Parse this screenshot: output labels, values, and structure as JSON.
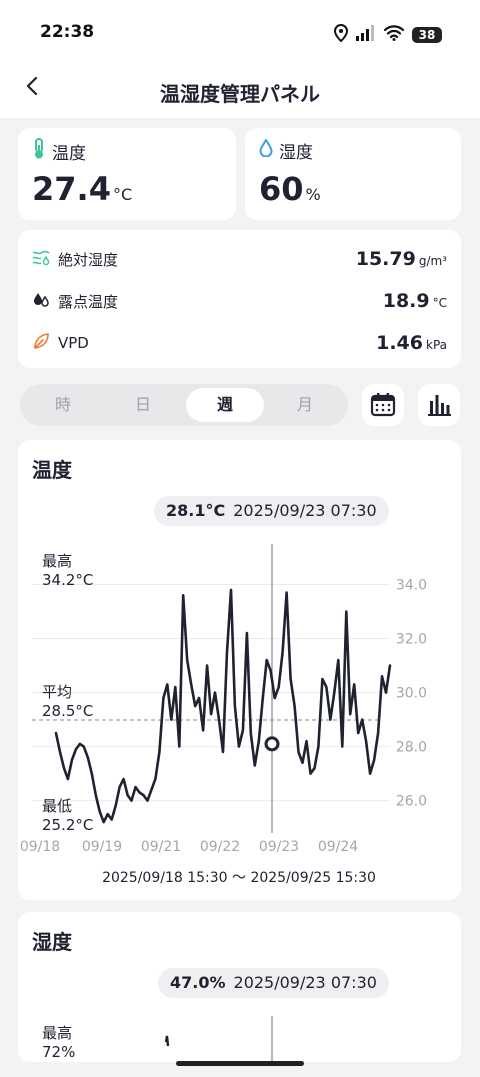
{
  "status": {
    "time": "22:38",
    "battery": "38"
  },
  "nav": {
    "title": "温湿度管理パネル"
  },
  "temperature": {
    "label": "温度",
    "value": "27.4",
    "unit": "°C"
  },
  "humidity": {
    "label": "湿度",
    "value": "60",
    "unit": "%"
  },
  "stats": [
    {
      "label": "絶対湿度",
      "value": "15.79",
      "unit": "g/m³"
    },
    {
      "label": "露点温度",
      "value": "18.9",
      "unit": "°C"
    },
    {
      "label": "VPD",
      "value": "1.46",
      "unit": "kPa"
    }
  ],
  "tabs": [
    {
      "label": "時",
      "active": false
    },
    {
      "label": "日",
      "active": false
    },
    {
      "label": "週",
      "active": true
    },
    {
      "label": "月",
      "active": false
    }
  ],
  "icons": {
    "calendar": "calendar-icon",
    "bars": "bar-chart-icon"
  },
  "colors": {
    "accent_temp": "#3ec49a",
    "accent_hum": "#3aa0e0",
    "accent_vpd": "#f07a2a",
    "line": "#1f2230"
  },
  "temp_chart": {
    "title": "温度",
    "tooltip_value": "28.1°C",
    "tooltip_time": "2025/09/23 07:30",
    "max_label": "最高",
    "max_value": "34.2°C",
    "avg_label": "平均",
    "avg_value": "28.5°C",
    "min_label": "最低",
    "min_value": "25.2°C",
    "range": "2025/09/18 15:30 〜 2025/09/25 15:30"
  },
  "hum_chart": {
    "title": "湿度",
    "tooltip_value": "47.0%",
    "tooltip_time": "2025/09/23 07:30",
    "max_label": "最高",
    "max_value": "72%"
  },
  "chart_data": {
    "type": "line",
    "title": "温度",
    "x_ticks": [
      "09/18",
      "09/19",
      "09/21",
      "09/22",
      "09/23",
      "09/24"
    ],
    "y_ticks": [
      "34.0",
      "32.0",
      "30.0",
      "28.0",
      "26.0"
    ],
    "ylim": [
      24.8,
      35.5
    ],
    "average": 28.5,
    "highlight": {
      "time": "2025/09/23 07:30",
      "value": 28.1
    },
    "series": [
      {
        "values": [
          28.5,
          27.8,
          27.2,
          26.8,
          27.5,
          27.9,
          28.1,
          28.0,
          27.6,
          27.0,
          26.2,
          25.6,
          25.2,
          25.5,
          25.3,
          25.8,
          26.5,
          26.8,
          26.2,
          26.0,
          26.5,
          26.3,
          26.2,
          26.0,
          26.4,
          26.8,
          27.8,
          29.8,
          30.3,
          29.0,
          30.2,
          28.0,
          33.6,
          31.2,
          30.3,
          29.5,
          29.8,
          28.6,
          31.0,
          29.2,
          30.0,
          29.0,
          27.8,
          31.5,
          33.8,
          29.5,
          28.0,
          28.6,
          32.2,
          28.5,
          27.3,
          28.2,
          29.8,
          31.2,
          30.8,
          29.8,
          30.2,
          31.5,
          33.7,
          30.5,
          29.5,
          27.8,
          27.4,
          28.2,
          27.0,
          27.2,
          28.0,
          30.5,
          30.2,
          29.0,
          30.0,
          31.2,
          28.0,
          33.0,
          29.2,
          30.3,
          28.5,
          29.0,
          28.2,
          27.0,
          27.5,
          28.5,
          30.6,
          30.0,
          31.0
        ]
      }
    ]
  }
}
